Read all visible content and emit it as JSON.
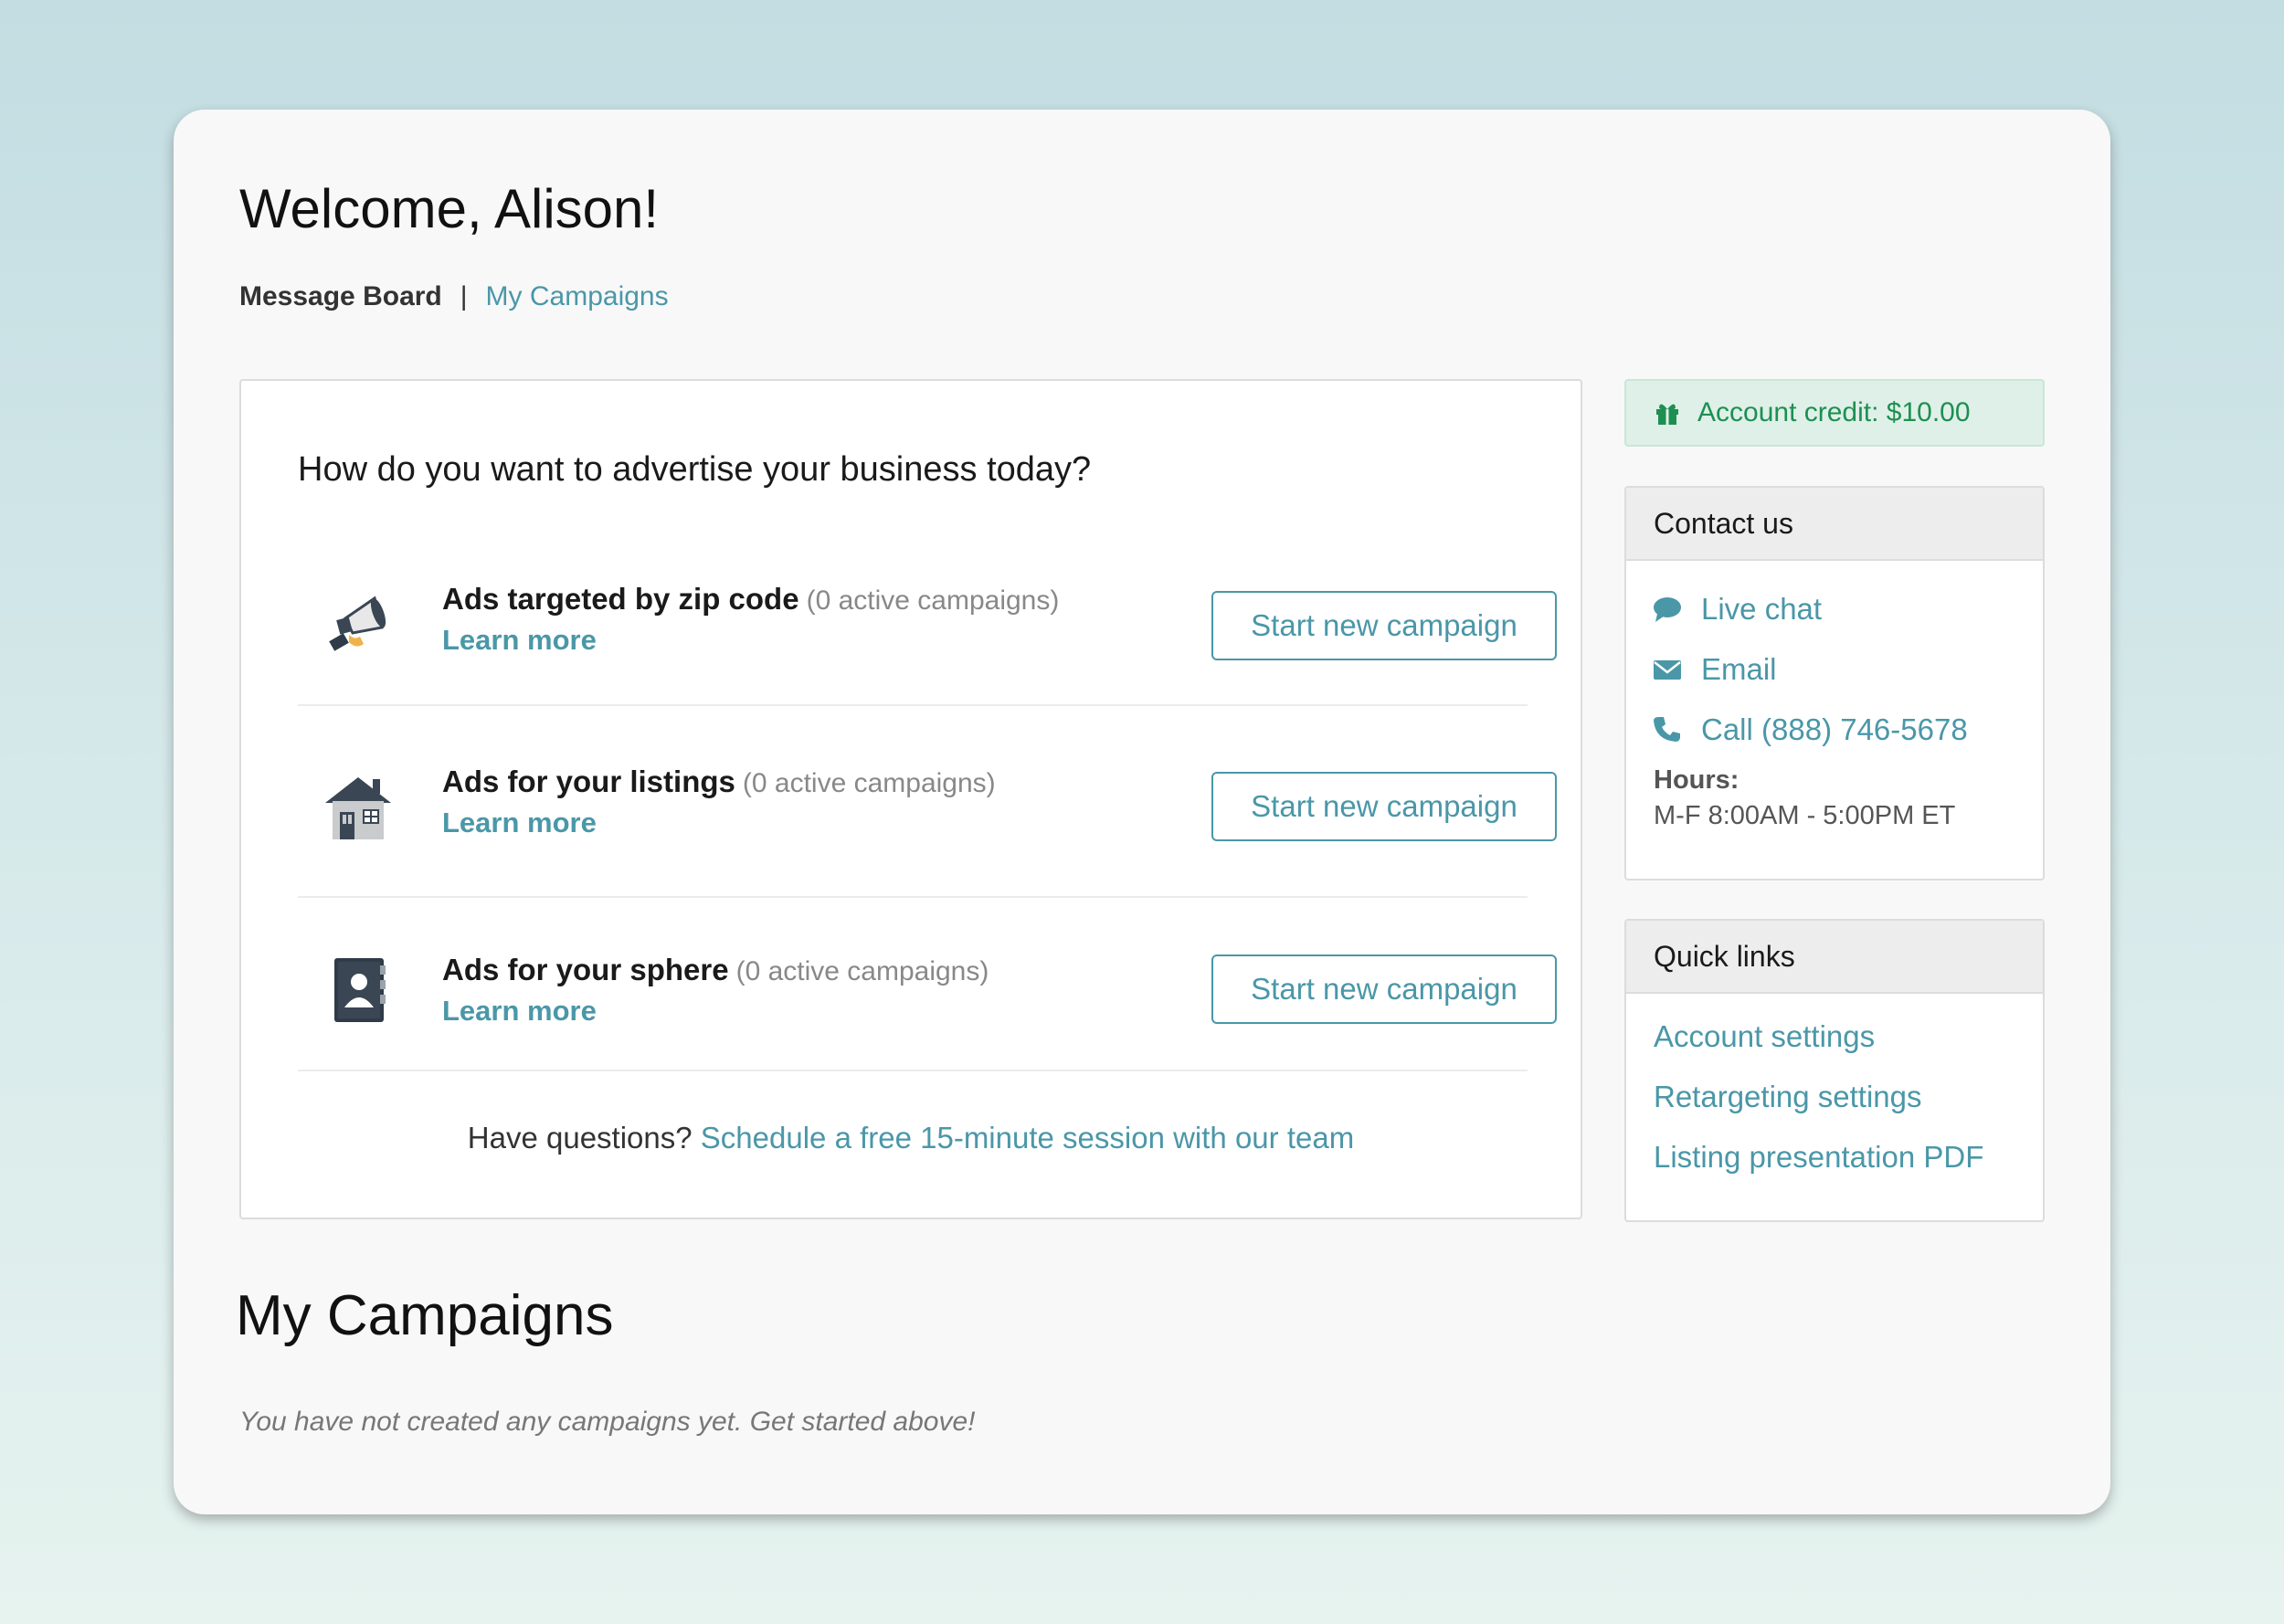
{
  "welcome": {
    "title": "Welcome, Alison!"
  },
  "subnav": {
    "current": "Message Board",
    "separator": "|",
    "link": "My Campaigns"
  },
  "advertise": {
    "question": "How do you want to advertise your business today?",
    "options": [
      {
        "name": "Ads targeted by zip code",
        "count": "(0 active campaigns)",
        "learn_more": "Learn more",
        "button": "Start new campaign",
        "icon": "megaphone-icon"
      },
      {
        "name": "Ads for your listings",
        "count": "(0 active campaigns)",
        "learn_more": "Learn more",
        "button": "Start new campaign",
        "icon": "house-icon"
      },
      {
        "name": "Ads for your sphere",
        "count": "(0 active campaigns)",
        "learn_more": "Learn more",
        "button": "Start new campaign",
        "icon": "contact-book-icon"
      }
    ],
    "questions_prefix": "Have questions?",
    "questions_link": "Schedule a free 15-minute session with our team"
  },
  "credit": {
    "label": "Account credit: $10.00",
    "icon": "gift-icon"
  },
  "contact": {
    "title": "Contact us",
    "items": [
      {
        "label": "Live chat",
        "icon": "chat-bubble-icon"
      },
      {
        "label": "Email",
        "icon": "envelope-icon"
      },
      {
        "label": "Call (888) 746-5678",
        "icon": "phone-icon"
      }
    ],
    "hours_label": "Hours:",
    "hours_value": "M-F 8:00AM - 5:00PM ET"
  },
  "quick_links": {
    "title": "Quick links",
    "items": [
      "Account settings",
      "Retargeting settings",
      "Listing presentation PDF"
    ]
  },
  "campaigns": {
    "title": "My Campaigns",
    "empty_message": "You have not created any campaigns yet. Get started above!"
  },
  "colors": {
    "accent": "#4a97a8",
    "credit_text": "#1e8f52",
    "credit_bg": "#dff0e8"
  }
}
